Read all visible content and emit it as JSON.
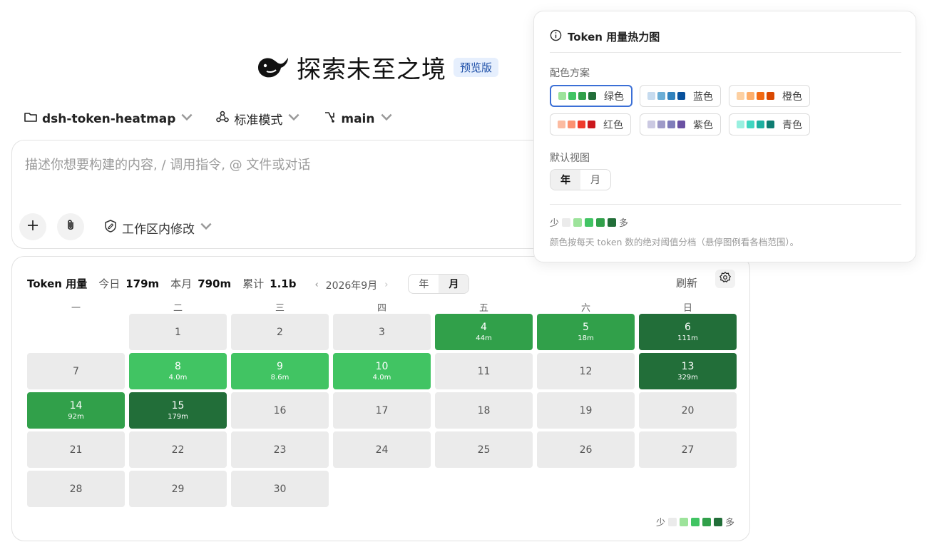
{
  "brand": {
    "title": "探索未至之境",
    "badge": "预览版"
  },
  "toolbar": {
    "repo": "dsh-token-heatmap",
    "mode": "标准模式",
    "branch": "main"
  },
  "prompt": {
    "placeholder": "描述你想要构建的内容, / 调用指令, @ 文件或对话",
    "workspace_label": "工作区内修改"
  },
  "card": {
    "title": "Token 用量",
    "stats": [
      {
        "label": "今日",
        "value": "179m"
      },
      {
        "label": "本月",
        "value": "790m"
      },
      {
        "label": "累计",
        "value": "1.1b"
      }
    ],
    "prev": "‹",
    "next": "›",
    "month_label": "2026年9月",
    "view_year": "年",
    "view_month": "月",
    "refresh": "刷新",
    "weekdays": [
      "一",
      "二",
      "三",
      "四",
      "五",
      "六",
      "日"
    ],
    "days": [
      {
        "d": "1",
        "v": "",
        "c": 0
      },
      {
        "d": "2",
        "v": "",
        "c": 0
      },
      {
        "d": "3",
        "v": "",
        "c": 0
      },
      {
        "d": "4",
        "v": "44m",
        "c": 3
      },
      {
        "d": "5",
        "v": "18m",
        "c": 3
      },
      {
        "d": "6",
        "v": "111m",
        "c": 4
      },
      {
        "d": "7",
        "v": "",
        "c": 0
      },
      {
        "d": "8",
        "v": "4.0m",
        "c": 2
      },
      {
        "d": "9",
        "v": "8.6m",
        "c": 2
      },
      {
        "d": "10",
        "v": "4.0m",
        "c": 2
      },
      {
        "d": "11",
        "v": "",
        "c": 0
      },
      {
        "d": "12",
        "v": "",
        "c": 0
      },
      {
        "d": "13",
        "v": "329m",
        "c": 4
      },
      {
        "d": "14",
        "v": "92m",
        "c": 3
      },
      {
        "d": "15",
        "v": "179m",
        "c": 4
      },
      {
        "d": "16",
        "v": "",
        "c": 0
      },
      {
        "d": "17",
        "v": "",
        "c": 0
      },
      {
        "d": "18",
        "v": "",
        "c": 0
      },
      {
        "d": "19",
        "v": "",
        "c": 0
      },
      {
        "d": "20",
        "v": "",
        "c": 0
      },
      {
        "d": "21",
        "v": "",
        "c": 0
      },
      {
        "d": "22",
        "v": "",
        "c": 0
      },
      {
        "d": "23",
        "v": "",
        "c": 0
      },
      {
        "d": "24",
        "v": "",
        "c": 0
      },
      {
        "d": "25",
        "v": "",
        "c": 0
      },
      {
        "d": "26",
        "v": "",
        "c": 0
      },
      {
        "d": "27",
        "v": "",
        "c": 0
      },
      {
        "d": "28",
        "v": "",
        "c": 0
      },
      {
        "d": "29",
        "v": "",
        "c": 0
      },
      {
        "d": "30",
        "v": "",
        "c": 0
      }
    ],
    "first_weekday_offset": 1,
    "legend_less": "少",
    "legend_more": "多"
  },
  "levels": [
    "#ebebeb",
    "#9de39b",
    "#41c463",
    "#31a04a",
    "#226e39"
  ],
  "popover": {
    "title": "Token 用量热力图",
    "scheme_label": "配色方案",
    "schemes": [
      {
        "name": "绿色",
        "colors": [
          "#9de39b",
          "#41c463",
          "#31a04a",
          "#226e39"
        ],
        "selected": true
      },
      {
        "name": "蓝色",
        "colors": [
          "#c6dbef",
          "#6baed6",
          "#3182bd",
          "#08519c"
        ],
        "selected": false
      },
      {
        "name": "橙色",
        "colors": [
          "#fdd0a2",
          "#fdae6b",
          "#f16913",
          "#d94801"
        ],
        "selected": false
      },
      {
        "name": "红色",
        "colors": [
          "#fcbba1",
          "#fc9272",
          "#ef3b2c",
          "#cb181d"
        ],
        "selected": false
      },
      {
        "name": "紫色",
        "colors": [
          "#cbc9e2",
          "#9e9ac8",
          "#807dba",
          "#6a51a3"
        ],
        "selected": false
      },
      {
        "name": "青色",
        "colors": [
          "#99f0e0",
          "#40d6c0",
          "#1eb0a0",
          "#0e7d72"
        ],
        "selected": false
      }
    ],
    "view_label": "默认视图",
    "view_year": "年",
    "view_month": "月",
    "legend_less": "少",
    "legend_more": "多",
    "note": "颜色按每天 token 数的绝对阈值分档（悬停图例看各档范围）。"
  }
}
